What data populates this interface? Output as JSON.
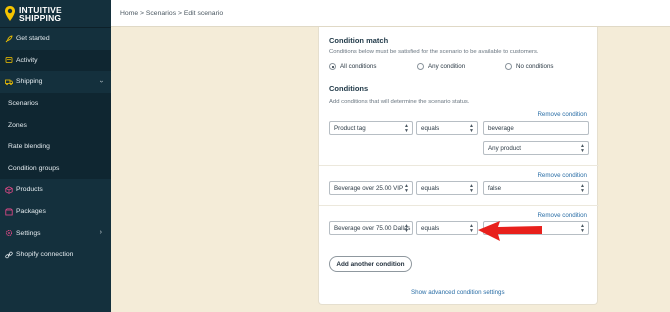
{
  "brand": {
    "line1": "INTUITIVE",
    "line2": "SHIPPING",
    "pin_color": "#f5c400"
  },
  "sidebar": {
    "items": [
      {
        "label": "Get started",
        "icon": "rocket-icon"
      },
      {
        "label": "Activity",
        "icon": "activity-icon"
      },
      {
        "label": "Shipping",
        "icon": "truck-icon"
      },
      {
        "label": "Scenarios"
      },
      {
        "label": "Zones"
      },
      {
        "label": "Rate blending"
      },
      {
        "label": "Condition groups"
      },
      {
        "label": "Products",
        "icon": "box-icon"
      },
      {
        "label": "Packages",
        "icon": "package-icon"
      },
      {
        "label": "Settings",
        "icon": "gear-icon"
      },
      {
        "label": "Shopify connection",
        "icon": "link-icon"
      }
    ]
  },
  "breadcrumb": "Home > Scenarios > Edit scenario",
  "condition_match": {
    "title": "Condition match",
    "description": "Conditions below must be satisfied for the scenario to be available to customers.",
    "options": [
      "All conditions",
      "Any condition",
      "No conditions"
    ],
    "selected": "All conditions"
  },
  "conditions": {
    "title": "Conditions",
    "description": "Add conditions that will determine the scenario status.",
    "remove_label": "Remove condition",
    "rows": [
      {
        "field": "Product tag",
        "operator": "equals",
        "value": "beverage",
        "extra": "Any product"
      },
      {
        "field": "Beverage over 25.00 VIP",
        "operator": "equals",
        "value": "false"
      },
      {
        "field": "Beverage over 75.00 Dallas",
        "operator": "equals",
        "value": ""
      }
    ],
    "add_button": "Add another condition",
    "advanced_link": "Show advanced condition settings"
  },
  "colors": {
    "sidebar_bg": "#14303d",
    "page_bg": "#f4ecd8",
    "link": "#2a6ea6",
    "arrow": "#e8201c"
  }
}
